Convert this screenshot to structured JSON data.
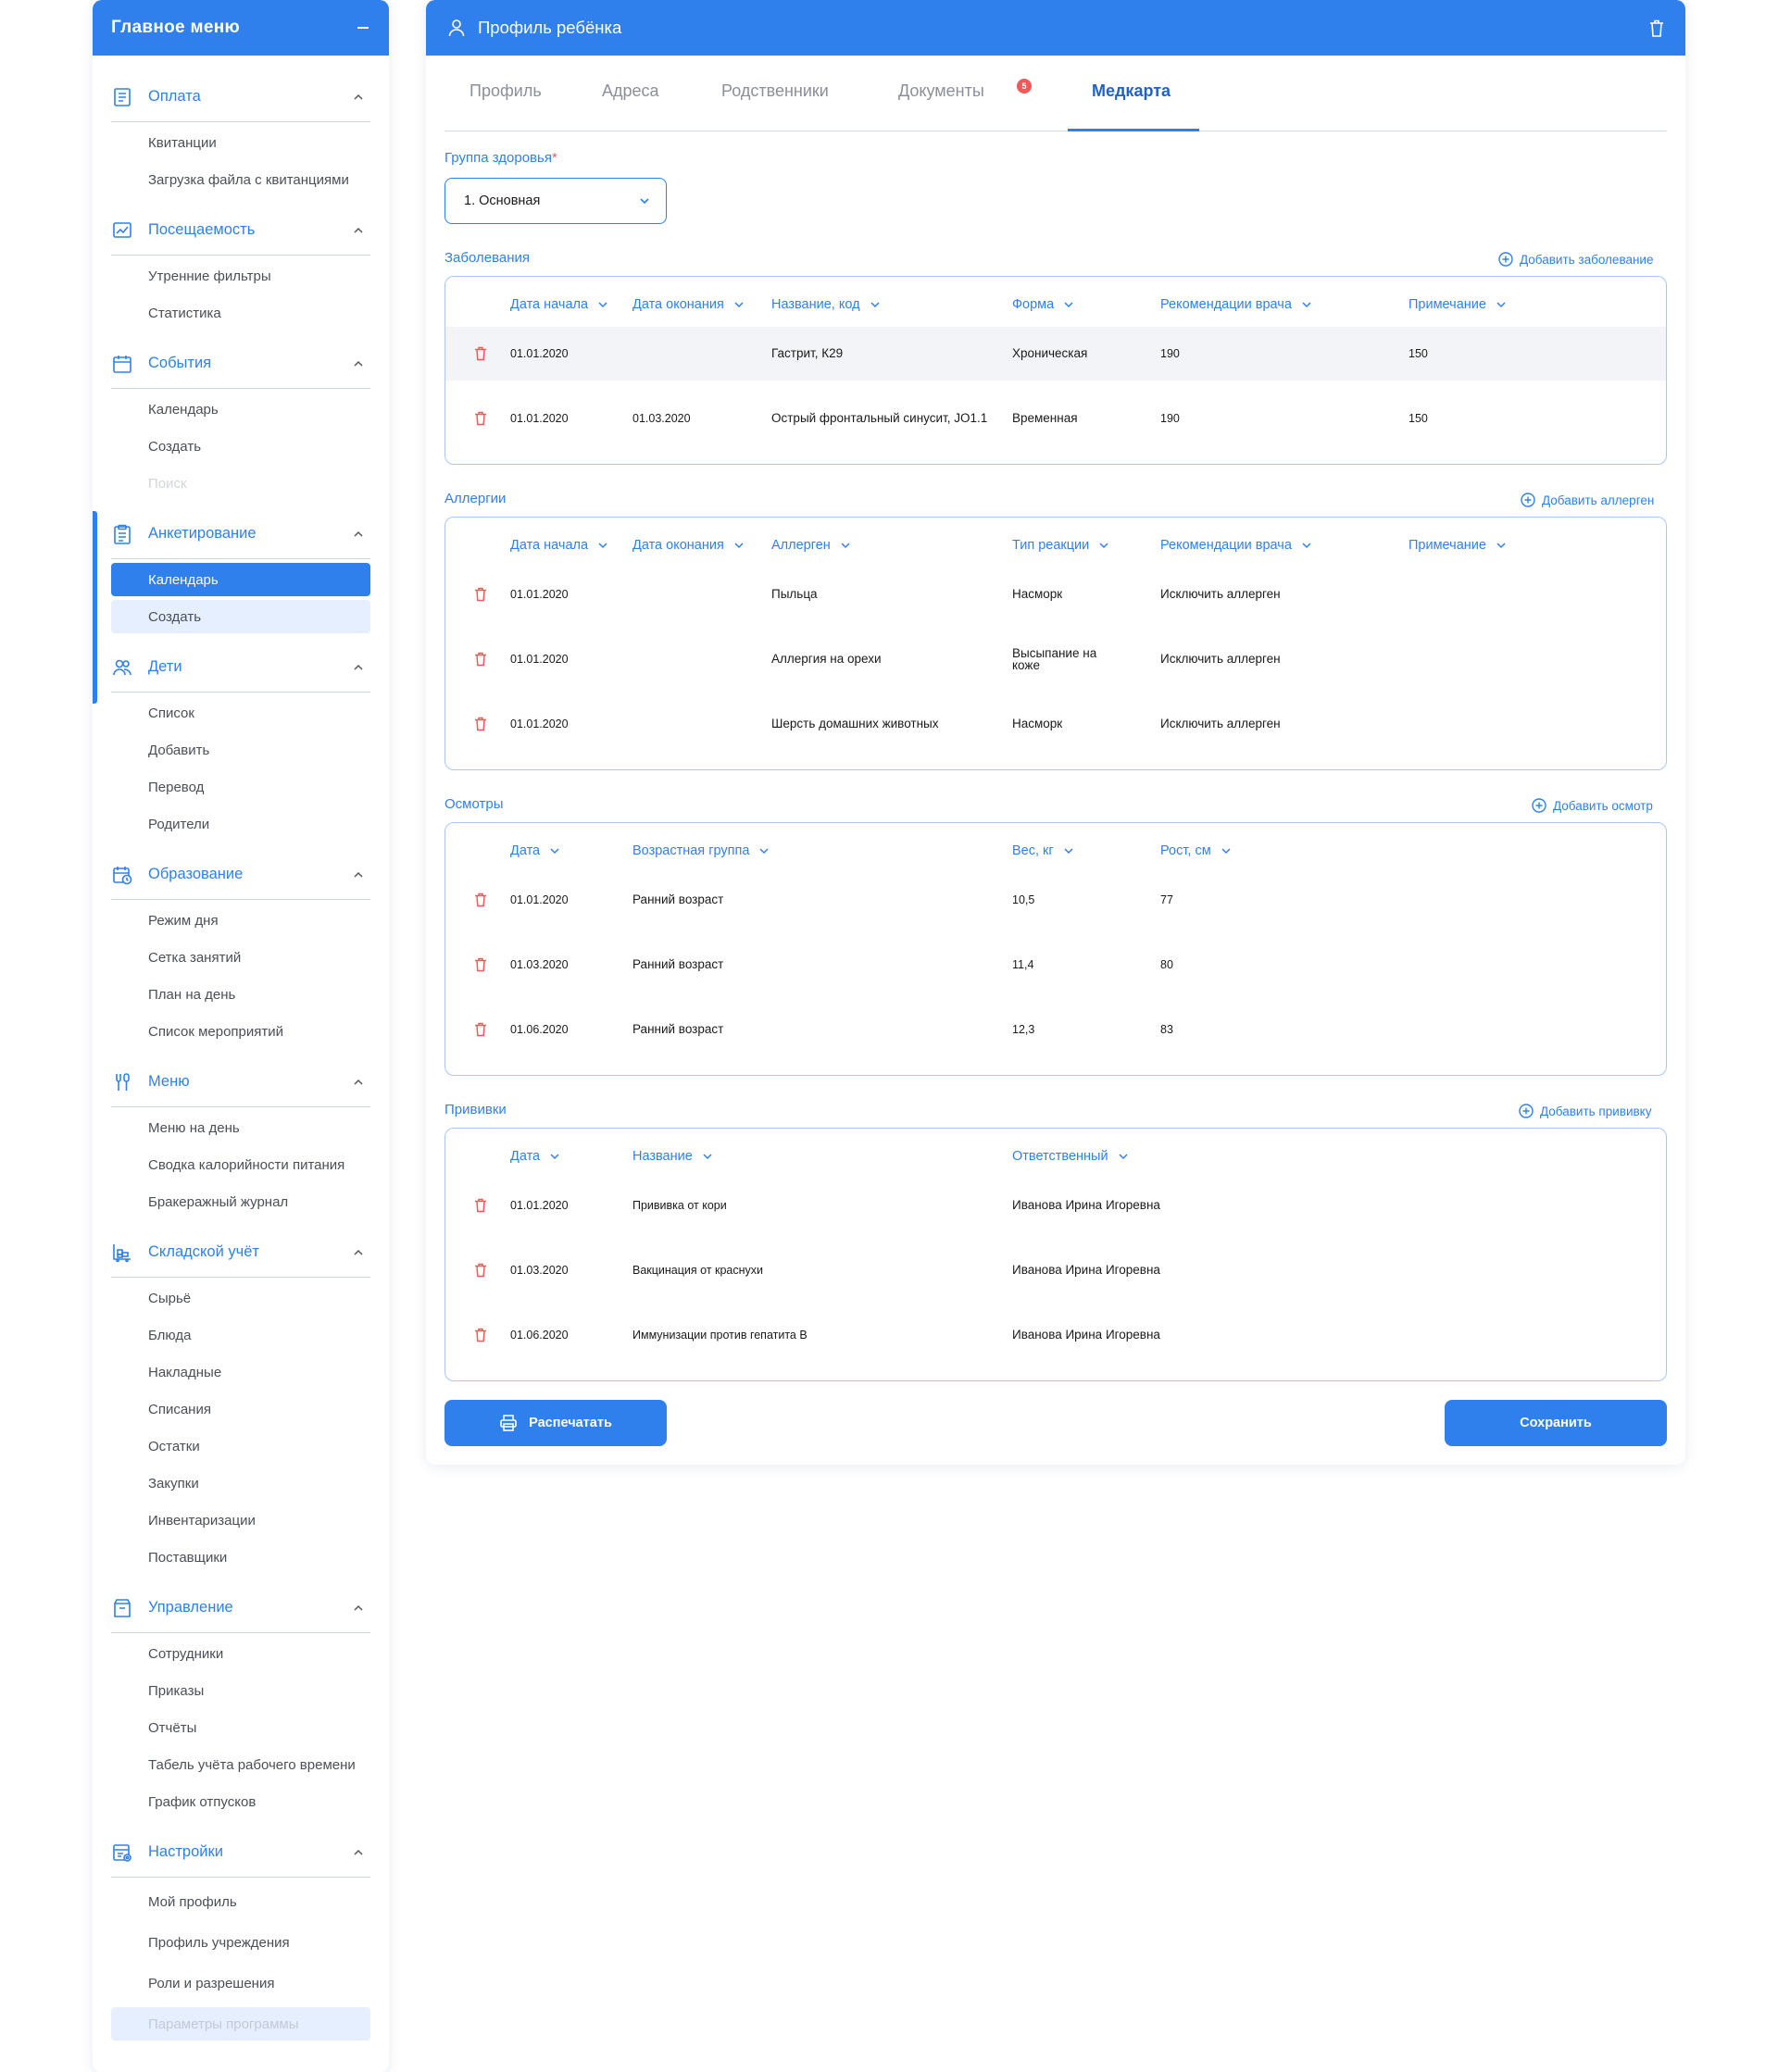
{
  "sidebar": {
    "title": "Главное  меню",
    "sections": [
      {
        "label": "Оплата",
        "icon": "receipt-icon",
        "items": [
          "Квитанции",
          "Загрузка файла с квитанциями"
        ]
      },
      {
        "label": "Посещаемость",
        "icon": "chart-icon",
        "items": [
          "Утренние фильтры",
          "Статистика"
        ]
      },
      {
        "label": "События",
        "icon": "calendar-icon",
        "items": [
          "Календарь",
          "Создать",
          "Поиск"
        ]
      },
      {
        "label": "Анкетирование",
        "icon": "clipboard-icon",
        "items": [
          "Календарь",
          "Создать"
        ]
      },
      {
        "label": "Дети",
        "icon": "children-icon",
        "items": [
          "Список",
          "Добавить",
          "Перевод",
          "Родители"
        ]
      },
      {
        "label": "Образование",
        "icon": "schedule-icon",
        "items": [
          "Режим дня",
          "Сетка занятий",
          "План на день",
          "Список мероприятий"
        ]
      },
      {
        "label": "Меню",
        "icon": "cutlery-icon",
        "items": [
          "Меню на день",
          "Сводка калорийности питания",
          "Бракеражный журнал"
        ]
      },
      {
        "label": "Складской учёт",
        "icon": "warehouse-icon",
        "items": [
          "Сырьё",
          "Блюда",
          "Накладные",
          "Списания",
          "Остатки",
          "Закупки",
          "Инвентаризации",
          "Поставщики"
        ]
      },
      {
        "label": "Управление",
        "icon": "management-icon",
        "items": [
          "Сотрудники",
          "Приказы",
          "Отчёты",
          "Табель учёта рабочего времени",
          "График отпусков"
        ]
      },
      {
        "label": "Настройки",
        "icon": "settings-icon",
        "items": [
          "Мой профиль",
          "Профиль учреждения",
          "Роли и разрешения",
          "Параметры программы"
        ]
      }
    ]
  },
  "page": {
    "title": "Профиль ребёнка",
    "tabs": [
      "Профиль",
      "Адреса",
      "Родственники",
      "Документы",
      "Медкарта"
    ],
    "documents_badge": "5",
    "active_tab": "Медкарта"
  },
  "health_group": {
    "label": "Группа здоровья",
    "required_mark": "*",
    "value": "1. Основная"
  },
  "diseases": {
    "title": "Заболевания",
    "add_label": "Добавить заболевание",
    "headers": [
      "Дата начала",
      "Дата оконания",
      "Название, код",
      "Форма",
      "Рекомендации врача",
      "Примечание"
    ],
    "rows": [
      [
        "01.01.2020",
        "",
        "Гастрит, К29",
        "Хроническая",
        "190",
        "150"
      ],
      [
        "01.01.2020",
        "01.03.2020",
        "Острый фронтальный синусит, JO1.1",
        "Временная",
        "190",
        "150"
      ]
    ]
  },
  "allergies": {
    "title": "Аллергии",
    "add_label": "Добавить аллерген",
    "headers": [
      "Дата начала",
      "Дата оконания",
      "Аллерген",
      "Тип реакции",
      "Рекомендации врача",
      "Примечание"
    ],
    "rows": [
      [
        "01.01.2020",
        "",
        "Пыльца",
        "Насморк",
        "Исключить аллерген",
        ""
      ],
      [
        "01.01.2020",
        "",
        "Аллергия на орехи",
        "Высыпание на коже",
        "Исключить аллерген",
        ""
      ],
      [
        "01.01.2020",
        "",
        "Шерсть домашних животных",
        "Насморк",
        "Исключить аллерген",
        ""
      ]
    ]
  },
  "exams": {
    "title": "Осмотры",
    "add_label": "Добавить осмотр",
    "headers": [
      "Дата",
      "Возрастная группа",
      "Вес, кг",
      "Рост, см"
    ],
    "rows": [
      [
        "01.01.2020",
        "Ранний возраст",
        "10,5",
        "77"
      ],
      [
        "01.03.2020",
        "Ранний возраст",
        "11,4",
        "80"
      ],
      [
        "01.06.2020",
        "Ранний возраст",
        "12,3",
        "83"
      ]
    ]
  },
  "vaccines": {
    "title": "Прививки",
    "add_label": "Добавить прививку",
    "headers": [
      "Дата",
      "Название",
      "Ответственный"
    ],
    "rows": [
      [
        "01.01.2020",
        "Прививка от кори",
        "Иванова Ирина Игоревна"
      ],
      [
        "01.03.2020",
        "Вакцинация от краснухи",
        "Иванова Ирина Игоревна"
      ],
      [
        "01.06.2020",
        "Иммунизации против гепатита В",
        "Иванова Ирина Игоревна"
      ]
    ]
  },
  "actions": {
    "print": "Распечатать",
    "save": "Сохранить"
  },
  "colors": {
    "accent": "#2f80ed",
    "delete": "#f05a5a",
    "badge": "#f05a5a"
  }
}
